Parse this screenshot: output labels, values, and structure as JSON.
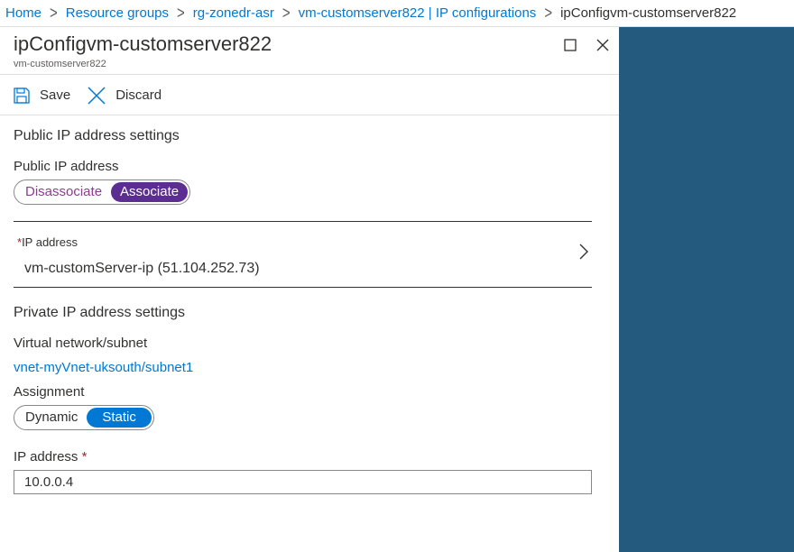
{
  "breadcrumb": {
    "items": [
      "Home",
      "Resource groups",
      "rg-zonedr-asr",
      "vm-customserver822 | IP configurations"
    ],
    "current": "ipConfigvm-customserver822"
  },
  "blade": {
    "title": "ipConfigvm-customserver822",
    "subtitle": "vm-customserver822"
  },
  "toolbar": {
    "save_label": "Save",
    "discard_label": "Discard"
  },
  "public_ip": {
    "heading": "Public IP address settings",
    "label": "Public IP address",
    "options": [
      "Disassociate",
      "Associate"
    ],
    "selected": "Associate",
    "ip_field": {
      "required_mark": "*",
      "label": "IP address",
      "value": "vm-customServer-ip (51.104.252.73)"
    }
  },
  "private_ip": {
    "heading": "Private IP address settings",
    "vnet_label": "Virtual network/subnet",
    "vnet_link": "vnet-myVnet-uksouth/subnet1",
    "assignment_label": "Assignment",
    "assignment_options": [
      "Dynamic",
      "Static"
    ],
    "assignment_selected": "Static",
    "ip_label": "IP address",
    "ip_required_mark": "*",
    "ip_value": "10.0.0.4"
  },
  "colors": {
    "link": "#0078d4",
    "purple_toggle": "#5c2e91",
    "blue_toggle": "#0078d4",
    "side_pane": "#245a7d",
    "required": "#a4262c"
  },
  "icons": {
    "save": "save-icon",
    "discard": "discard-icon",
    "maximize": "maximize-icon",
    "close": "close-icon",
    "chevron": "chevron-right-icon"
  }
}
